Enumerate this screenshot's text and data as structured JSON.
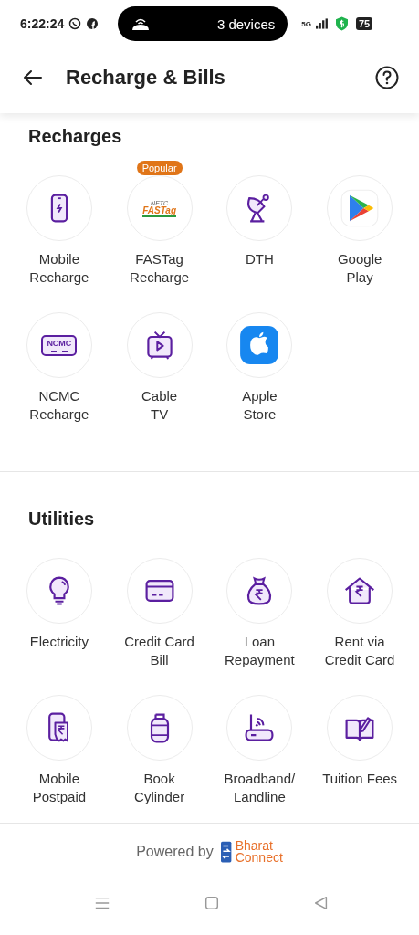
{
  "status_bar": {
    "time": "6:22:24",
    "hotspot": "3 devices",
    "network": "5G",
    "battery": "75"
  },
  "header": {
    "title": "Recharge & Bills"
  },
  "sections": [
    {
      "title": "Recharges",
      "items": [
        {
          "label": "Mobile\nRecharge",
          "kind": "mobile"
        },
        {
          "label": "FASTag\nRecharge",
          "kind": "fastag",
          "badge": "Popular",
          "logo_texts": [
            "NETC",
            "FASTag"
          ]
        },
        {
          "label": "DTH",
          "kind": "dth"
        },
        {
          "label": "Google\nPlay",
          "kind": "google-play"
        },
        {
          "label": "NCMC\nRecharge",
          "kind": "ncmc",
          "icon_text": "NCMC"
        },
        {
          "label": "Cable\nTV",
          "kind": "tv"
        },
        {
          "label": "Apple\nStore",
          "kind": "apple"
        }
      ]
    },
    {
      "title": "Utilities",
      "items": [
        {
          "label": "Electricity",
          "kind": "bulb"
        },
        {
          "label": "Credit Card\nBill",
          "kind": "card"
        },
        {
          "label": "Loan\nRepayment",
          "kind": "loan"
        },
        {
          "label": "Rent via\nCredit Card",
          "kind": "rent"
        },
        {
          "label": "Mobile\nPostpaid",
          "kind": "postpaid"
        },
        {
          "label": "Book\nCylinder",
          "kind": "cylinder"
        },
        {
          "label": "Broadband/\nLandline",
          "kind": "router"
        },
        {
          "label": "Tuition Fees",
          "kind": "book"
        }
      ]
    }
  ],
  "footer": {
    "text": "Powered by",
    "logo_texts": [
      "Bharat",
      "Connect"
    ]
  }
}
